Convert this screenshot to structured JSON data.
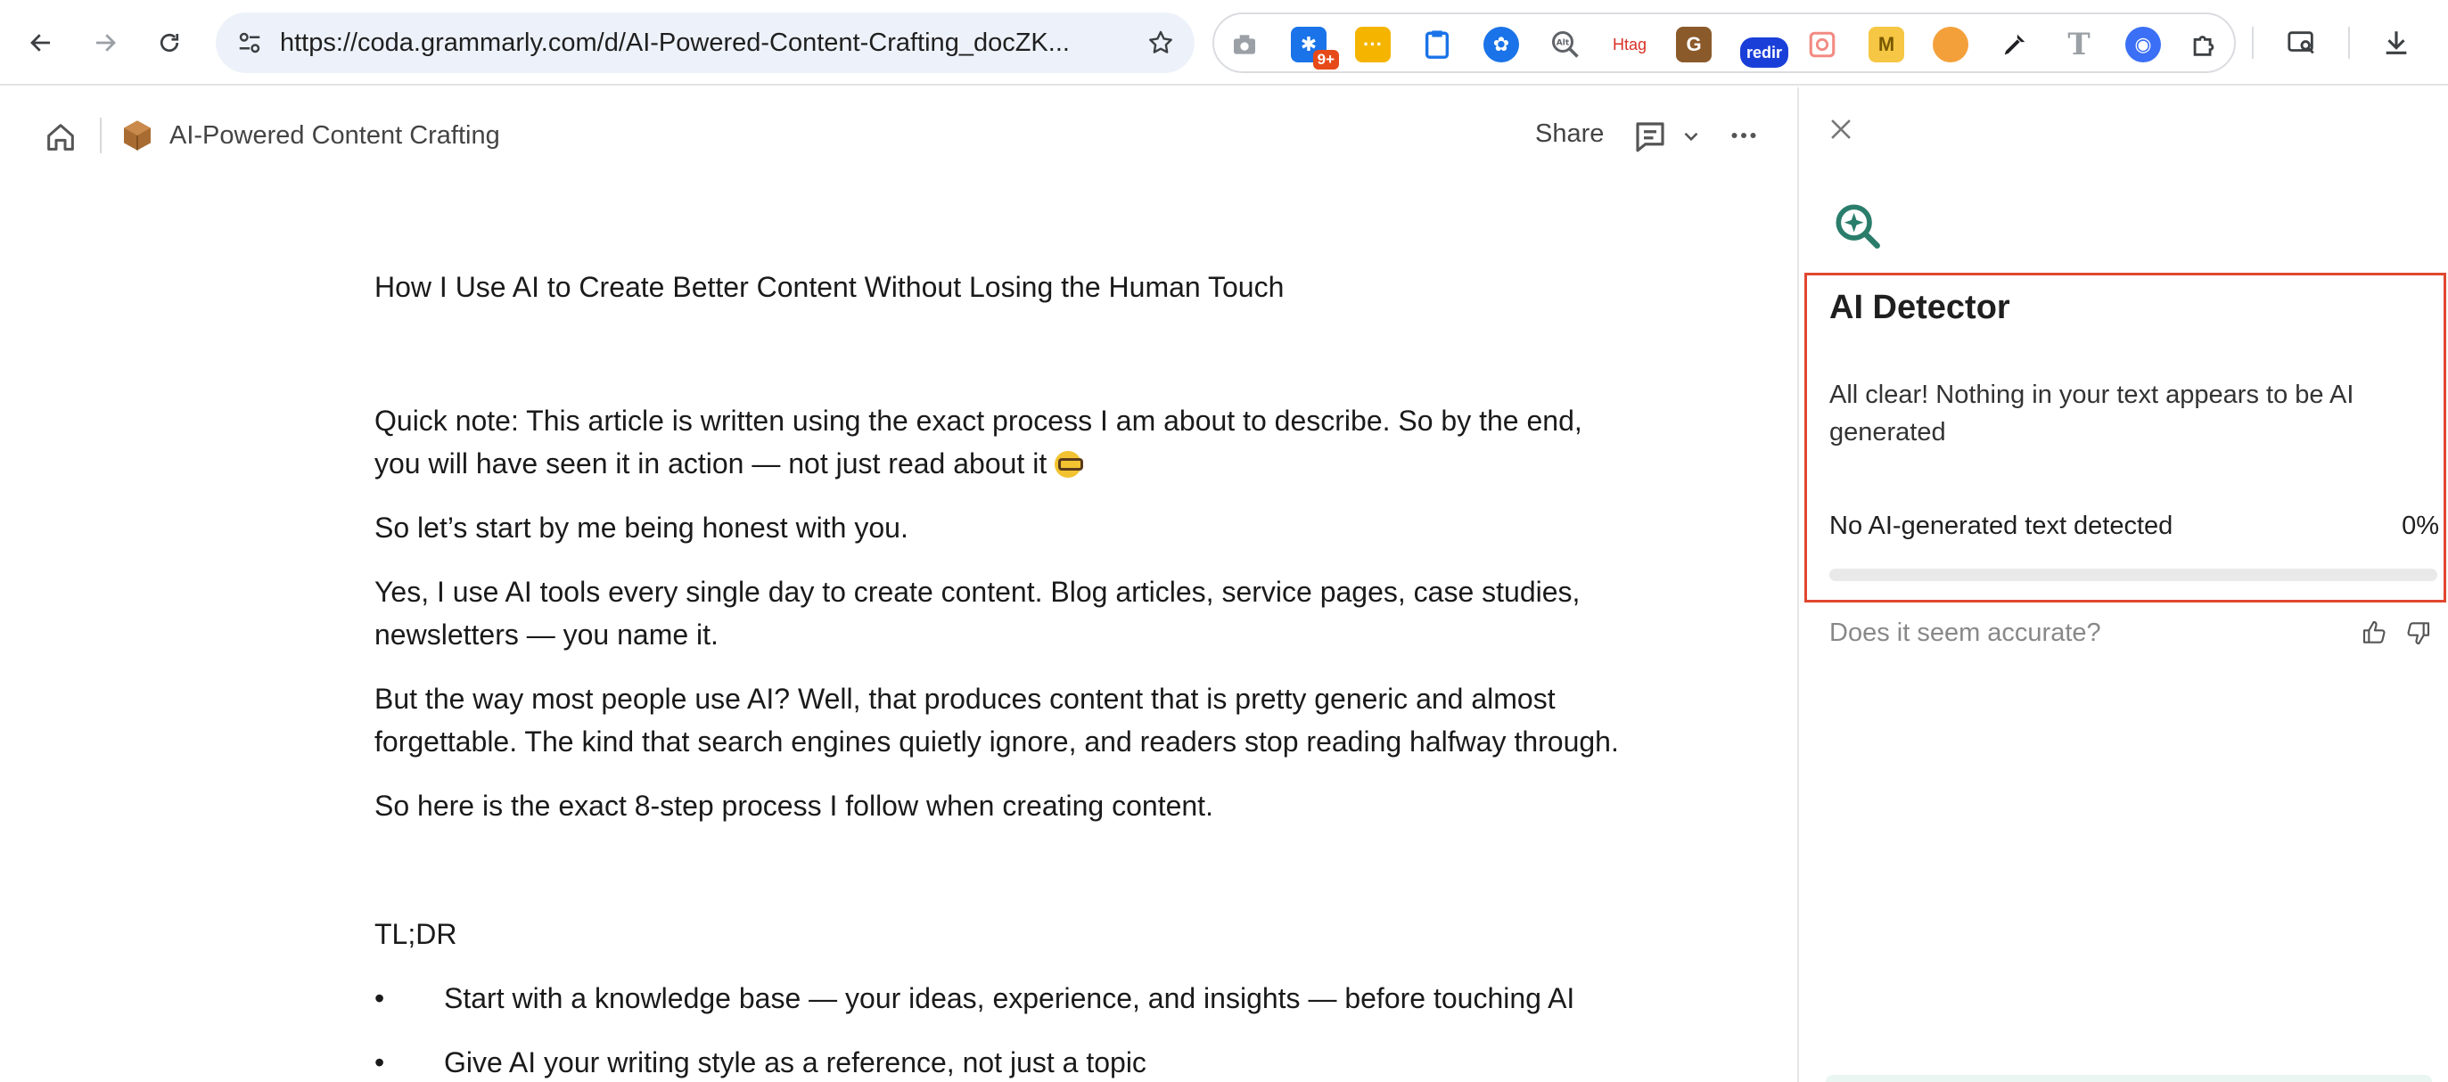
{
  "browser": {
    "url": "https://coda.grammarly.com/d/AI-Powered-Content-Crafting_docZK...",
    "extensions": [
      {
        "name": "camera-icon",
        "color": "#5f6368"
      },
      {
        "name": "gear-badge-icon",
        "color": "#1a73e8",
        "badge": "9+"
      },
      {
        "name": "dots-icon",
        "color": "#f4b400"
      },
      {
        "name": "clipboard-icon",
        "color": "#1a73e8"
      },
      {
        "name": "flower-icon",
        "color": "#1a73e8"
      },
      {
        "name": "alt-search-icon",
        "color": "#5f6368",
        "label": "Alt"
      },
      {
        "name": "htag-icon",
        "color": "#d93025",
        "label": "Htag"
      },
      {
        "name": "grammarly-g-icon",
        "color": "#8b5a2b",
        "label": "G"
      },
      {
        "name": "redir-icon",
        "color": "#1a3fd9",
        "label": "redir"
      },
      {
        "name": "screenshot-icon",
        "color": "#f28b82"
      },
      {
        "name": "m-icon",
        "color": "#f6c744",
        "label": "M"
      },
      {
        "name": "egg-icon",
        "color": "#f4a03a"
      },
      {
        "name": "eyedropper-icon",
        "color": "#202124"
      },
      {
        "name": "text-t-icon",
        "color": "#9aa0a6",
        "label": "T"
      },
      {
        "name": "eye-icon",
        "color": "#3b6ff5"
      },
      {
        "name": "puzzle-icon",
        "color": "#5f6368"
      }
    ]
  },
  "doc_header": {
    "title": "AI-Powered Content Crafting",
    "share_label": "Share"
  },
  "document": {
    "heading": "How I Use AI to Create Better Content Without Losing the Human Touch",
    "p1_line1": "Quick note: This article is written using the exact process I am about to describe. So by the end,",
    "p1_line2": "you will have seen it in action — not just read about it",
    "p2": "So let’s start by me being honest with you.",
    "p3_line1": "Yes, I use AI tools every single day to create content. Blog articles, service pages, case studies,",
    "p3_line2": "newsletters — you name it.",
    "p4_line1": "But the way most people use AI? Well, that produces content that is pretty generic and almost",
    "p4_line2": "forgettable. The kind that search engines quietly ignore, and readers stop reading halfway through.",
    "p5": "So here is the exact 8-step process I follow when creating content.",
    "tldr": "TL;DR",
    "bullet_char": "•",
    "bullets": [
      "Start with a knowledge base — your ideas, experience, and insights — before touching AI",
      "Give AI your writing style as a reference, not just a topic"
    ]
  },
  "panel": {
    "title": "AI Detector",
    "message": "All clear! Nothing in your text appears to be AI generated",
    "result_label": "No AI-generated text detected",
    "result_value": "0%",
    "result_fraction": 0,
    "accuracy_prompt": "Does it seem accurate?",
    "accent_color": "#e0472f"
  }
}
